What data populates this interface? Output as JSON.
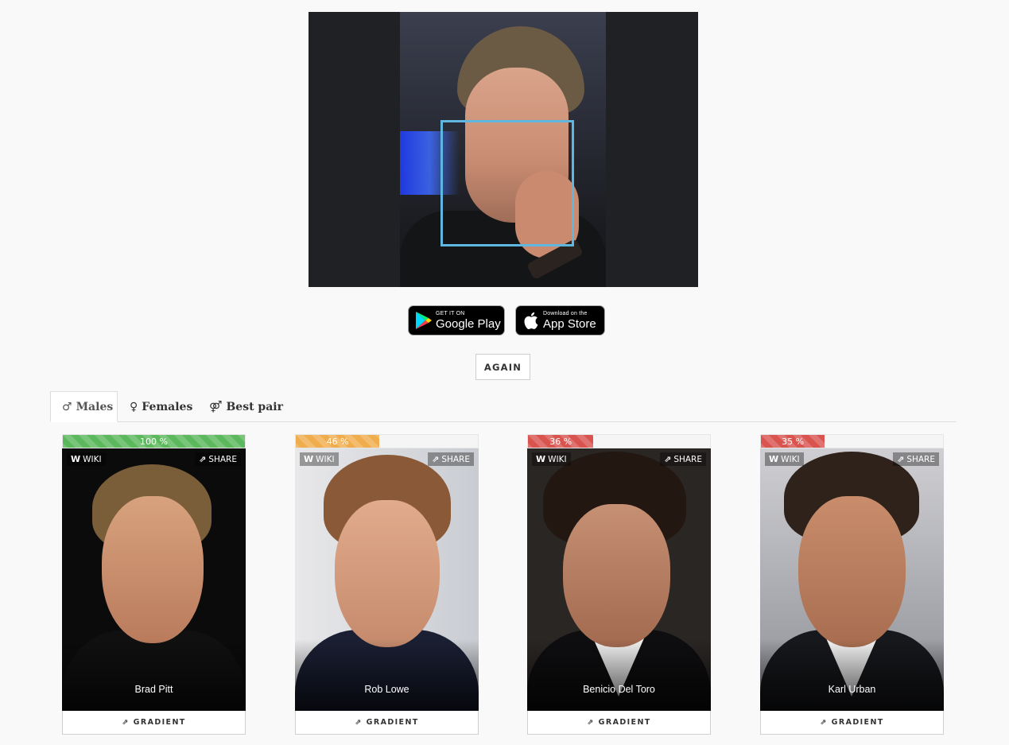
{
  "stores": {
    "google": {
      "small": "GET IT ON",
      "big": "Google Play",
      "icon": "google-play-icon"
    },
    "apple": {
      "small": "Download on the",
      "big": "App Store",
      "icon": "apple-icon"
    }
  },
  "again_label": "AGAIN",
  "tabs": [
    {
      "label": "Males",
      "icon": "male-icon",
      "glyph": "♂",
      "active": true
    },
    {
      "label": "Females",
      "icon": "female-icon",
      "glyph": "♀",
      "active": false
    },
    {
      "label": "Best pair",
      "icon": "pair-icon",
      "glyph": "⚤",
      "active": false
    }
  ],
  "results": [
    {
      "name": "Brad Pitt",
      "percent_label": "100 %",
      "percent": 100,
      "bar_color": "#5cb85c"
    },
    {
      "name": "Rob Lowe",
      "percent_label": "46 %",
      "percent": 46,
      "bar_color": "#f0ad4e"
    },
    {
      "name": "Benicio Del Toro",
      "percent_label": "36 %",
      "percent": 36,
      "bar_color": "#d9534f"
    },
    {
      "name": "Karl Urban",
      "percent_label": "35 %",
      "percent": 35,
      "bar_color": "#d9534f"
    }
  ],
  "card_labels": {
    "wiki": "WIKI",
    "share": "SHARE",
    "gradient": "GRADIENT"
  },
  "colors": {
    "face_box": "#5fb7e0",
    "page_bg": "#f9f9f9"
  }
}
